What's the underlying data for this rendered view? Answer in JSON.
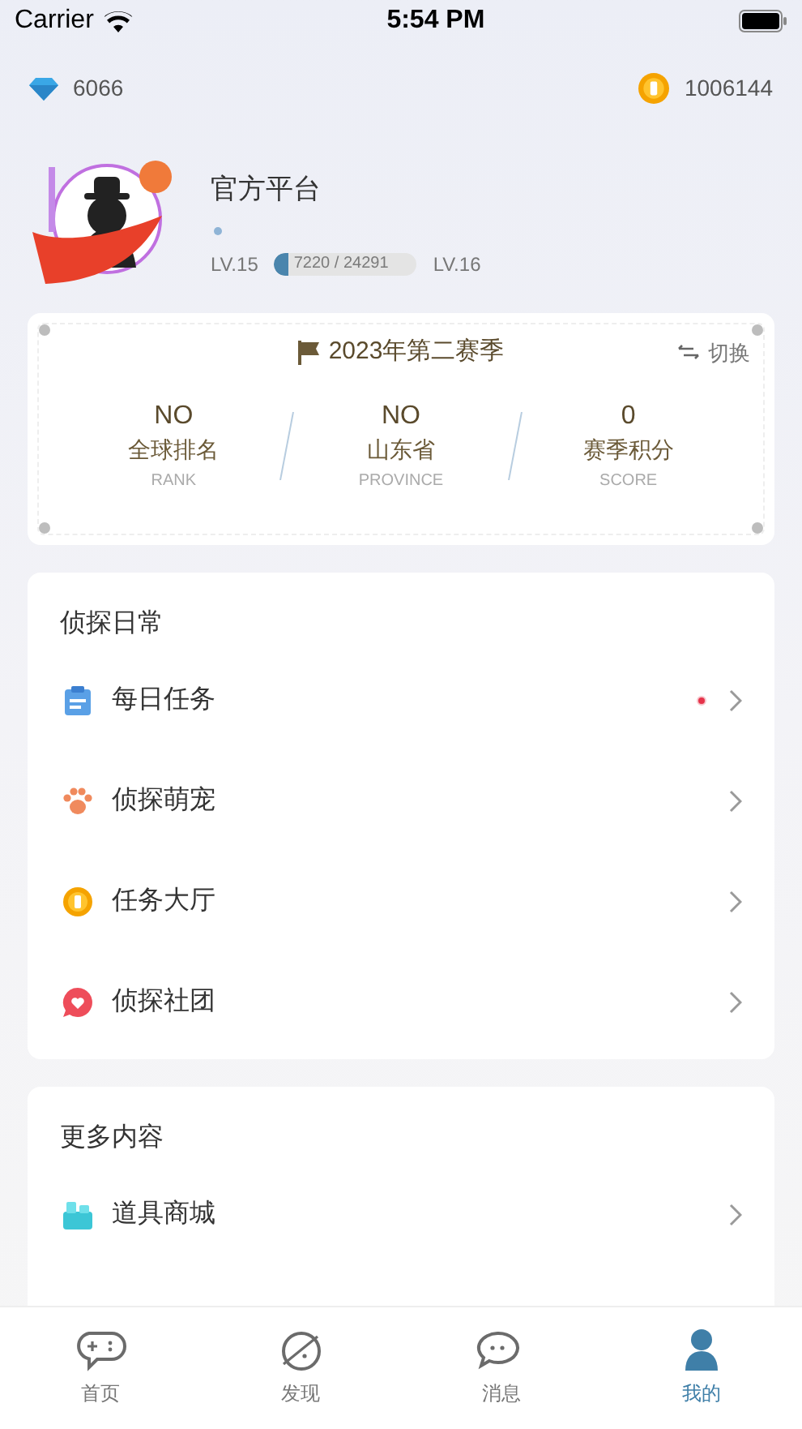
{
  "status_bar": {
    "carrier": "Carrier",
    "time": "5:54 PM"
  },
  "wallet": {
    "diamonds": "6066",
    "coins": "1006144"
  },
  "profile": {
    "name": "官方平台",
    "level_current": "LV.15",
    "level_next": "LV.16",
    "progress_text": "7220 / 24291",
    "level": 0.1
  },
  "season": {
    "title": "2023年第二赛季",
    "switch_label": "切换",
    "stats": [
      {
        "value": "NO",
        "label": "全球排名",
        "sublabel": "RANK"
      },
      {
        "value": "NO",
        "label": "山东省",
        "sublabel": "PROVINCE"
      },
      {
        "value": "0",
        "label": "赛季积分",
        "sublabel": "SCORE"
      }
    ]
  },
  "sections": [
    {
      "title": "侦探日常",
      "items": [
        {
          "kind": "clipboard",
          "label": "每日任务",
          "notification": true
        },
        {
          "kind": "paw",
          "label": "侦探萌宠",
          "notification": false
        },
        {
          "kind": "coin",
          "label": "任务大厅",
          "notification": false
        },
        {
          "kind": "heart",
          "label": "侦探社团",
          "notification": false
        }
      ]
    },
    {
      "title": "更多内容",
      "items": [
        {
          "kind": "shop",
          "label": "道具商城",
          "notification": false
        }
      ]
    }
  ],
  "tab_bar": [
    {
      "kind": "home",
      "label": "首页",
      "selected": false
    },
    {
      "kind": "discover",
      "label": "发现",
      "selected": false
    },
    {
      "kind": "message",
      "label": "消息",
      "selected": false
    },
    {
      "kind": "me",
      "label": "我的",
      "selected": true
    }
  ]
}
